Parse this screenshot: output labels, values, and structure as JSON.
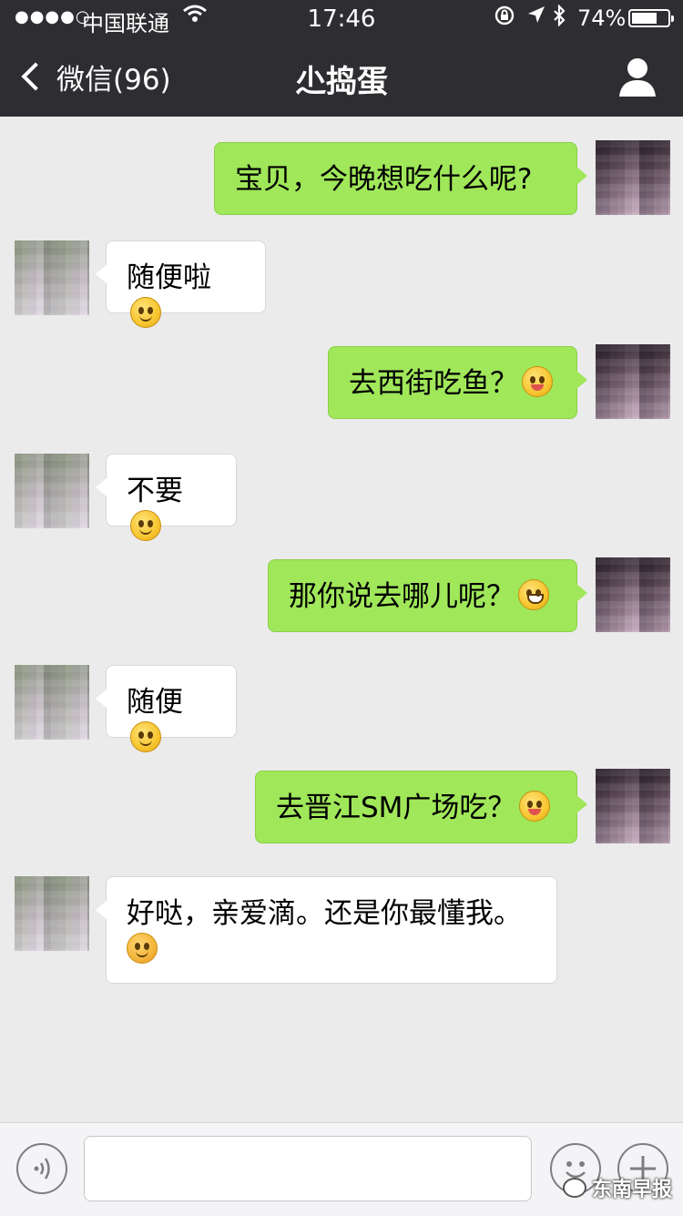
{
  "status_bar": {
    "signal": "●●●●○",
    "carrier": "中国联通",
    "time": "17:46",
    "battery_percent_text": "74%",
    "battery_level": 0.74
  },
  "nav": {
    "back_label": "微信(96)",
    "title": "尐捣蛋"
  },
  "messages": [
    {
      "from": "me",
      "text": "宝贝，今晚想吃什么呢?",
      "emoji": ""
    },
    {
      "from": "her",
      "text": "随便啦",
      "emoji": "smile"
    },
    {
      "from": "me",
      "text": "去西街吃鱼？",
      "emoji": "tongue-wink"
    },
    {
      "from": "her",
      "text": "不要",
      "emoji": "smile"
    },
    {
      "from": "me",
      "text": "那你说去哪儿呢？",
      "emoji": "grin"
    },
    {
      "from": "her",
      "text": "随便",
      "emoji": "smile"
    },
    {
      "from": "me",
      "text": "去晋江SM广场吃？",
      "emoji": "tongue-wink"
    },
    {
      "from": "her",
      "text": "好哒，亲爱滴。还是你最懂我。",
      "emoji": "shy"
    }
  ],
  "input": {
    "value": "",
    "placeholder": ""
  },
  "icons": {
    "back": "chevron-left-icon",
    "profile": "person-icon",
    "voice": "voice-icon",
    "emoji": "emoji-icon",
    "plus": "plus-icon"
  },
  "colors": {
    "nav_bg": "#2e2e32",
    "chat_bg": "#ebebeb",
    "my_bubble": "#a0e75a",
    "her_bubble": "#ffffff"
  },
  "watermark": "东南早报"
}
